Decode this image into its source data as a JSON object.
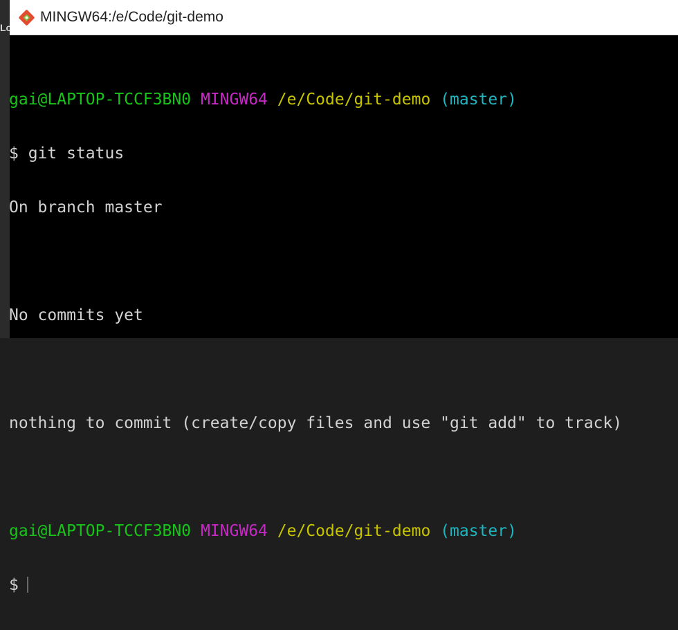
{
  "desktop": {
    "left_fragment": "Lo"
  },
  "window": {
    "title": "MINGW64:/e/Code/git-demo",
    "icon": "git-icon"
  },
  "terminal": {
    "prompt1": {
      "user_host": "gai@LAPTOP-TCCF3BN0",
      "shell": "MINGW64",
      "path": "/e/Code/git-demo",
      "branch": "(master)"
    },
    "command": "$ git status",
    "output": [
      "On branch master",
      "",
      "No commits yet",
      "",
      "nothing to commit (create/copy files and use \"git add\" to track)",
      ""
    ],
    "prompt2": {
      "user_host": "gai@LAPTOP-TCCF3BN0",
      "shell": "MINGW64",
      "path": "/e/Code/git-demo",
      "branch": "(master)"
    },
    "current_prompt": "$"
  },
  "colors": {
    "user_host": "#18c418",
    "shell": "#c628c6",
    "path": "#c7c400",
    "branch": "#1fb5bf",
    "text": "#d2d2d2",
    "background": "#000000"
  }
}
